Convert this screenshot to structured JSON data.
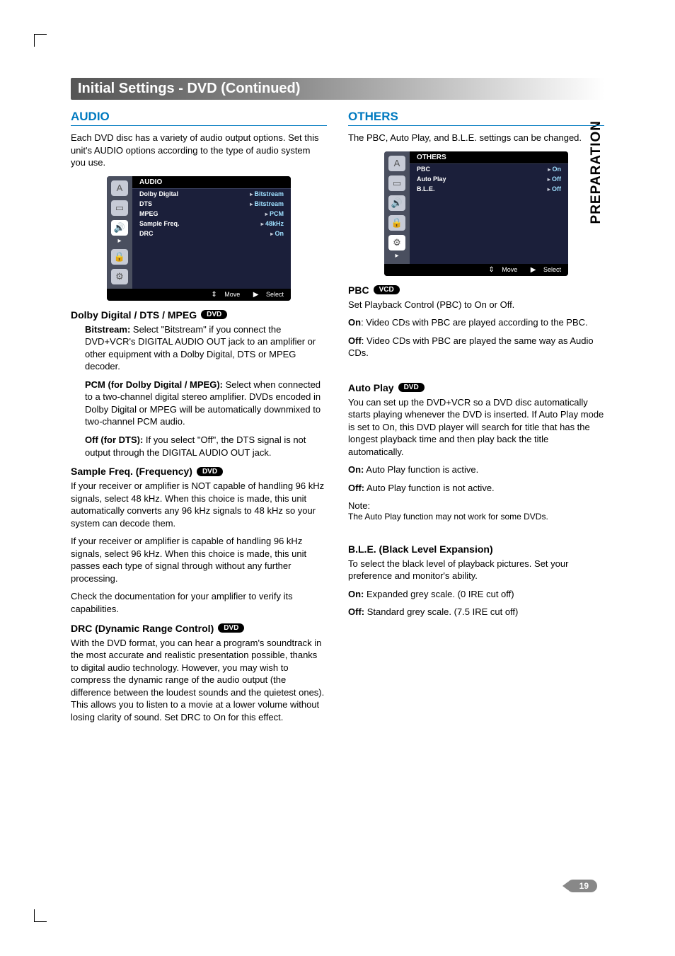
{
  "side_tab": "PREPARATION",
  "page_number": "19",
  "header_bar": "Initial Settings - DVD (Continued)",
  "left": {
    "title": "AUDIO",
    "intro": "Each DVD disc has a variety of audio output options. Set this unit's AUDIO options according to the type of audio system you use.",
    "menu": {
      "title": "AUDIO",
      "rows": [
        {
          "label": "Dolby Digital",
          "value": "Bitstream"
        },
        {
          "label": "DTS",
          "value": "Bitstream"
        },
        {
          "label": "MPEG",
          "value": "PCM"
        },
        {
          "label": "Sample Freq.",
          "value": "48kHz"
        },
        {
          "label": "DRC",
          "value": "On"
        }
      ],
      "footer_move": "Move",
      "footer_select": "Select"
    },
    "sub1": {
      "title": "Dolby Digital / DTS / MPEG",
      "pill": "DVD",
      "p1_label": "Bitstream:",
      "p1": " Select \"Bitstream\" if you connect the DVD+VCR's DIGITAL AUDIO OUT jack to an amplifier or other equipment with a Dolby Digital, DTS or MPEG decoder.",
      "p2_label": "PCM (for Dolby Digital / MPEG):",
      "p2": " Select when connected to a two-channel digital stereo amplifier. DVDs encoded in Dolby Digital or MPEG will be automatically downmixed to two-channel PCM audio.",
      "p3_label": "Off (for DTS):",
      "p3": " If you select \"Off\", the DTS signal is not output through the DIGITAL AUDIO OUT jack."
    },
    "sub2": {
      "title": "Sample Freq. (Frequency)",
      "pill": "DVD",
      "p1": "If your receiver or amplifier is NOT capable of handling 96 kHz signals, select 48 kHz. When this choice is made, this unit automatically converts any 96 kHz signals to 48 kHz so your system can decode them.",
      "p2": "If your receiver or amplifier is capable of handling 96 kHz signals, select 96 kHz. When this choice is made, this unit passes each type of signal through without any further processing.",
      "p3": "Check the documentation for your amplifier to verify its capabilities."
    },
    "sub3": {
      "title": "DRC (Dynamic Range Control)",
      "pill": "DVD",
      "p1": "With the DVD format, you can hear a program's soundtrack in the most accurate and realistic presentation possible, thanks to digital audio technology. However, you may wish to compress the dynamic range of the audio output (the difference between the loudest sounds and the quietest ones). This allows you to listen to a movie at a lower volume without losing clarity of sound. Set DRC to On for this effect."
    }
  },
  "right": {
    "title": "OTHERS",
    "intro": "The PBC, Auto Play, and B.L.E. settings can be changed.",
    "menu": {
      "title": "OTHERS",
      "rows": [
        {
          "label": "PBC",
          "value": "On"
        },
        {
          "label": "Auto Play",
          "value": "Off"
        },
        {
          "label": "B.L.E.",
          "value": "Off"
        }
      ],
      "footer_move": "Move",
      "footer_select": "Select"
    },
    "sub1": {
      "title": "PBC",
      "pill": "VCD",
      "p1": "Set Playback Control (PBC) to On or Off.",
      "p2_label": "On",
      "p2": ": Video CDs with PBC are played according to the PBC.",
      "p3_label": "Off",
      "p3": ": Video CDs with PBC are played the same way as Audio CDs."
    },
    "sub2": {
      "title": "Auto Play",
      "pill": "DVD",
      "p1": "You can set up the DVD+VCR so a DVD disc automatically starts playing whenever the DVD is inserted. If Auto Play mode is set to On, this DVD player will search for title that has the longest playback time and then play back the title automatically.",
      "p2_label": "On:",
      "p2": " Auto Play function is active.",
      "p3_label": "Off:",
      "p3": " Auto Play function is not active.",
      "note_label": "Note:",
      "note": "The Auto Play function may not work for some DVDs."
    },
    "sub3": {
      "title": "B.L.E. (Black Level Expansion)",
      "p1": "To select the black level of playback pictures. Set your preference and monitor's ability.",
      "p2_label": "On:",
      "p2": " Expanded grey scale. (0 IRE cut off)",
      "p3_label": "Off:",
      "p3": " Standard grey scale. (7.5 IRE cut off)"
    }
  }
}
